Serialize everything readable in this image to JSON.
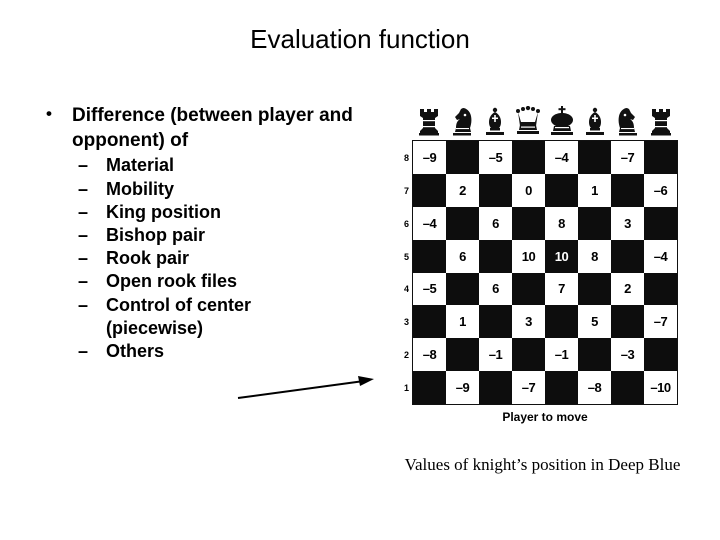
{
  "slide": {
    "title": "Evaluation function"
  },
  "body": {
    "bullet": {
      "marker": "•",
      "line1": "Difference (between",
      "line2": "player and opponent) of"
    },
    "sub_marker": "–",
    "sub_items": [
      {
        "label": "Material"
      },
      {
        "label": "Mobility"
      },
      {
        "label": "King position"
      },
      {
        "label": "Bishop pair"
      },
      {
        "label": "Rook pair"
      },
      {
        "label": "Open rook files"
      },
      {
        "label": "Control of center",
        "line2": "(piecewise)"
      },
      {
        "label": "Others"
      }
    ]
  },
  "figure": {
    "caption": "Values of knight’s position in Deep Blue",
    "board_caption": "Player to move",
    "piece_row": [
      {
        "name": "rook"
      },
      {
        "name": "knight"
      },
      {
        "name": "bishop"
      },
      {
        "name": "queen"
      },
      {
        "name": "king"
      },
      {
        "name": "bishop"
      },
      {
        "name": "knight"
      },
      {
        "name": "rook"
      }
    ],
    "rank_labels": [
      "8",
      "7",
      "6",
      "5",
      "4",
      "3",
      "2",
      "1"
    ],
    "board": {
      "note": "Knight position values; light squares show black numerals, one dark square (e5) shows a white numeral, other dark squares are illegible in the scan.",
      "rows": [
        {
          "rank": "8",
          "squares": [
            {
              "shade": "light",
              "value": "–9"
            },
            {
              "shade": "dark",
              "value": ""
            },
            {
              "shade": "light",
              "value": "–5"
            },
            {
              "shade": "dark",
              "value": ""
            },
            {
              "shade": "light",
              "value": "–4"
            },
            {
              "shade": "dark",
              "value": ""
            },
            {
              "shade": "light",
              "value": "–7"
            },
            {
              "shade": "dark",
              "value": ""
            }
          ]
        },
        {
          "rank": "7",
          "squares": [
            {
              "shade": "dark",
              "value": ""
            },
            {
              "shade": "light",
              "value": "2"
            },
            {
              "shade": "dark",
              "value": ""
            },
            {
              "shade": "light",
              "value": "0"
            },
            {
              "shade": "dark",
              "value": ""
            },
            {
              "shade": "light",
              "value": "1"
            },
            {
              "shade": "dark",
              "value": ""
            },
            {
              "shade": "light",
              "value": "–6"
            }
          ]
        },
        {
          "rank": "6",
          "squares": [
            {
              "shade": "light",
              "value": "–4"
            },
            {
              "shade": "dark",
              "value": ""
            },
            {
              "shade": "light",
              "value": "6"
            },
            {
              "shade": "dark",
              "value": ""
            },
            {
              "shade": "light",
              "value": "8"
            },
            {
              "shade": "dark",
              "value": ""
            },
            {
              "shade": "light",
              "value": "3"
            },
            {
              "shade": "dark",
              "value": ""
            }
          ]
        },
        {
          "rank": "5",
          "squares": [
            {
              "shade": "dark",
              "value": ""
            },
            {
              "shade": "light",
              "value": "6"
            },
            {
              "shade": "dark",
              "value": ""
            },
            {
              "shade": "light",
              "value": "10"
            },
            {
              "shade": "dark",
              "value": "10"
            },
            {
              "shade": "light",
              "value": "8"
            },
            {
              "shade": "dark",
              "value": ""
            },
            {
              "shade": "light",
              "value": "–4"
            }
          ]
        },
        {
          "rank": "4",
          "squares": [
            {
              "shade": "light",
              "value": "–5"
            },
            {
              "shade": "dark",
              "value": ""
            },
            {
              "shade": "light",
              "value": "6"
            },
            {
              "shade": "dark",
              "value": ""
            },
            {
              "shade": "light",
              "value": "7"
            },
            {
              "shade": "dark",
              "value": ""
            },
            {
              "shade": "light",
              "value": "2"
            },
            {
              "shade": "dark",
              "value": ""
            }
          ]
        },
        {
          "rank": "3",
          "squares": [
            {
              "shade": "dark",
              "value": ""
            },
            {
              "shade": "light",
              "value": "1"
            },
            {
              "shade": "dark",
              "value": ""
            },
            {
              "shade": "light",
              "value": "3"
            },
            {
              "shade": "dark",
              "value": ""
            },
            {
              "shade": "light",
              "value": "5"
            },
            {
              "shade": "dark",
              "value": ""
            },
            {
              "shade": "light",
              "value": "–7"
            }
          ]
        },
        {
          "rank": "2",
          "squares": [
            {
              "shade": "light",
              "value": "–8"
            },
            {
              "shade": "dark",
              "value": ""
            },
            {
              "shade": "light",
              "value": "–1"
            },
            {
              "shade": "dark",
              "value": ""
            },
            {
              "shade": "light",
              "value": "–1"
            },
            {
              "shade": "dark",
              "value": ""
            },
            {
              "shade": "light",
              "value": "–3"
            },
            {
              "shade": "dark",
              "value": ""
            }
          ]
        },
        {
          "rank": "1",
          "squares": [
            {
              "shade": "dark",
              "value": ""
            },
            {
              "shade": "light",
              "value": "–9"
            },
            {
              "shade": "dark",
              "value": ""
            },
            {
              "shade": "light",
              "value": "–7"
            },
            {
              "shade": "dark",
              "value": ""
            },
            {
              "shade": "light",
              "value": "–8"
            },
            {
              "shade": "dark",
              "value": ""
            },
            {
              "shade": "light",
              "value": "–10"
            }
          ]
        }
      ]
    }
  },
  "colors": {
    "text": "#000000",
    "background": "#ffffff",
    "board_dark": "#0d0d0d",
    "board_light": "#ffffff"
  }
}
